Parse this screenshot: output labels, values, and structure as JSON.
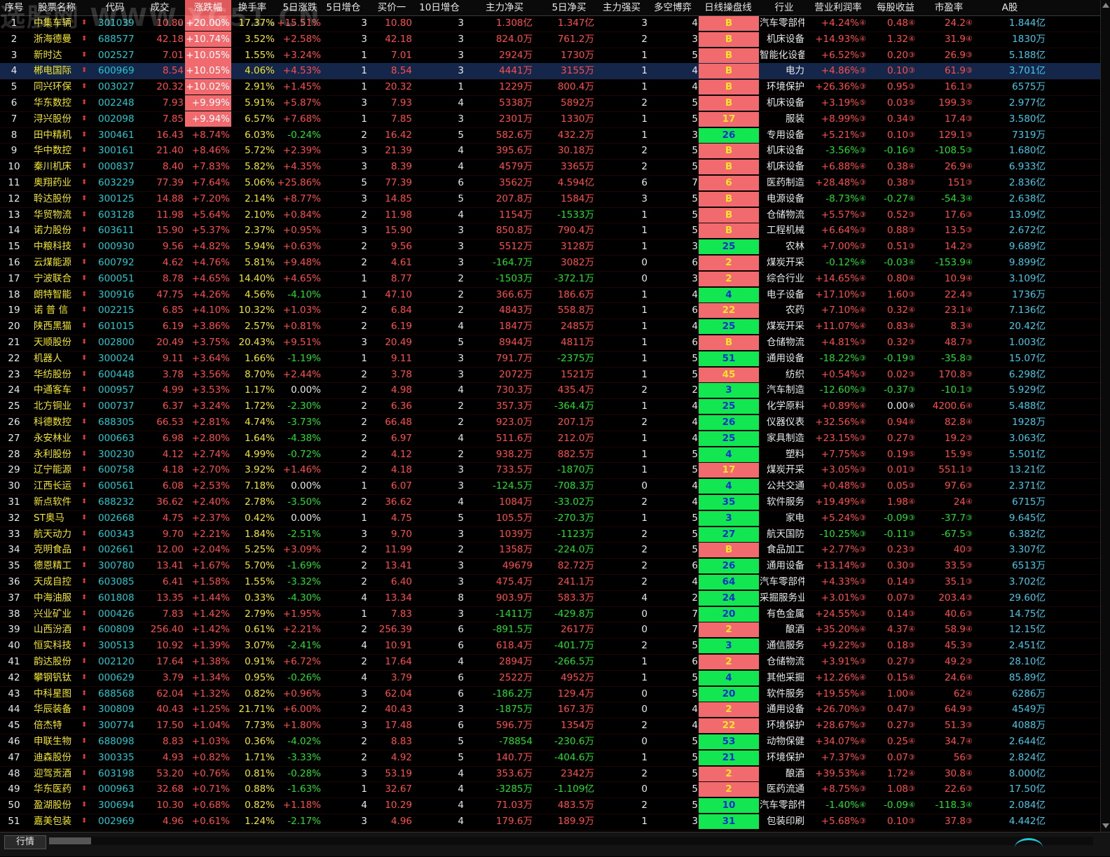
{
  "watermark": "选股网 WWW.XG51.CN",
  "headers": [
    "序号",
    "股票名称",
    "代码",
    "成交",
    "涨跌幅",
    "换手率",
    "5日涨跌",
    "5日增仓",
    "买价一",
    "10日增仓",
    "主力净买",
    "5日净买",
    "主力强买",
    "多空博弈",
    "日线操盘线",
    "行业",
    "营业利润率",
    "每股收益",
    "市盈率",
    "A股"
  ],
  "bottom_tab": "行情",
  "rows": [
    [
      "1",
      "中集车辆",
      "301039",
      "10.80",
      "+20.00%",
      "17.37%",
      "+15.51%",
      "3",
      "10.80",
      "3",
      "1.308亿",
      "1.347亿",
      "3",
      "4",
      "B",
      "汽车零部件",
      "+4.24%",
      "④",
      "0.48",
      "④",
      "24.2",
      "④",
      "1.844亿"
    ],
    [
      "2",
      "浙海德曼",
      "688577",
      "42.18",
      "+10.74%",
      "3.52%",
      "+2.58%",
      "3",
      "42.18",
      "3",
      "824.0万",
      "761.2万",
      "2",
      "3",
      "B",
      "机床设备",
      "+14.93%",
      "④",
      "1.32",
      "④",
      "31.9",
      "④",
      "1830万"
    ],
    [
      "3",
      "新时达",
      "002527",
      "7.01",
      "+10.05%",
      "1.55%",
      "+3.24%",
      "1",
      "7.01",
      "3",
      "2924万",
      "1730万",
      "1",
      "5",
      "B",
      "智能化设备",
      "+6.52%",
      "③",
      "0.20",
      "③",
      "26.9",
      "③",
      "5.188亿"
    ],
    [
      "4",
      "郴电国际",
      "600969",
      "8.54",
      "+10.05%",
      "4.06%",
      "+4.53%",
      "1",
      "8.54",
      "3",
      "4441万",
      "3155万",
      "1",
      "4",
      "B",
      "电力",
      "+4.86%",
      "③",
      "0.10",
      "③",
      "61.9",
      "③",
      "3.701亿"
    ],
    [
      "5",
      "同兴环保",
      "003027",
      "20.32",
      "+10.02%",
      "2.91%",
      "+1.45%",
      "1",
      "20.32",
      "1",
      "1229万",
      "800.4万",
      "1",
      "4",
      "B",
      "环境保护",
      "+26.36%",
      "③",
      "0.95",
      "③",
      "16.1",
      "③",
      "6575万"
    ],
    [
      "6",
      "华东数控",
      "002248",
      "7.93",
      "+9.99%",
      "5.91%",
      "+5.87%",
      "3",
      "7.93",
      "4",
      "5338万",
      "5892万",
      "2",
      "5",
      "B",
      "机床设备",
      "+3.19%",
      "⑤",
      "0.03",
      "⑤",
      "199.3",
      "⑤",
      "2.977亿"
    ],
    [
      "7",
      "浔兴股份",
      "002098",
      "7.85",
      "+9.94%",
      "6.57%",
      "+7.68%",
      "1",
      "7.85",
      "3",
      "2301万",
      "1330万",
      "1",
      "5",
      "17",
      "服装",
      "+8.99%",
      "③",
      "0.34",
      "③",
      "17.4",
      "③",
      "3.580亿"
    ],
    [
      "8",
      "田中精机",
      "300461",
      "16.43",
      "+8.74%",
      "6.03%",
      "-0.24%",
      "2",
      "16.42",
      "5",
      "582.6万",
      "432.2万",
      "1",
      "3",
      "26",
      "专用设备",
      "+5.21%",
      "③",
      "0.10",
      "③",
      "129.1",
      "③",
      "7319万"
    ],
    [
      "9",
      "华中数控",
      "300161",
      "21.40",
      "+8.46%",
      "5.72%",
      "+2.39%",
      "3",
      "21.39",
      "4",
      "395.6万",
      "30.18万",
      "2",
      "5",
      "B",
      "机床设备",
      "-3.56%",
      "③",
      "-0.16",
      "③",
      "-108.5",
      "③",
      "1.680亿"
    ],
    [
      "10",
      "秦川机床",
      "000837",
      "8.40",
      "+7.83%",
      "5.82%",
      "+4.35%",
      "3",
      "8.39",
      "4",
      "4579万",
      "3365万",
      "2",
      "5",
      "B",
      "机床设备",
      "+6.88%",
      "④",
      "0.38",
      "④",
      "26.9",
      "④",
      "6.933亿"
    ],
    [
      "11",
      "奥翔药业",
      "603229",
      "77.39",
      "+7.64%",
      "5.06%",
      "+25.86%",
      "5",
      "77.39",
      "6",
      "3562万",
      "4.594亿",
      "6",
      "7",
      "6",
      "医药制造",
      "+28.48%",
      "③",
      "0.38",
      "③",
      "151",
      "③",
      "2.836亿"
    ],
    [
      "12",
      "聆达股份",
      "300125",
      "14.88",
      "+7.20%",
      "2.14%",
      "+8.77%",
      "3",
      "14.85",
      "5",
      "207.8万",
      "1584万",
      "3",
      "5",
      "B",
      "电源设备",
      "-8.73%",
      "④",
      "-0.27",
      "④",
      "-54.3",
      "④",
      "2.638亿"
    ],
    [
      "13",
      "华贸物流",
      "603128",
      "11.98",
      "+5.64%",
      "2.10%",
      "+0.84%",
      "2",
      "11.98",
      "4",
      "1154万",
      "-1533万",
      "1",
      "5",
      "B",
      "仓储物流",
      "+5.57%",
      "③",
      "0.52",
      "③",
      "17.6",
      "③",
      "13.09亿"
    ],
    [
      "14",
      "诺力股份",
      "603611",
      "15.90",
      "+5.37%",
      "2.37%",
      "+0.95%",
      "3",
      "15.90",
      "3",
      "850.8万",
      "790.4万",
      "1",
      "5",
      "B",
      "工程机械",
      "+6.64%",
      "③",
      "0.88",
      "③",
      "13.5",
      "③",
      "2.672亿"
    ],
    [
      "15",
      "中粮科技",
      "000930",
      "9.56",
      "+4.82%",
      "5.94%",
      "+0.63%",
      "2",
      "9.56",
      "3",
      "5512万",
      "3128万",
      "1",
      "3",
      "25",
      "农林",
      "+7.00%",
      "③",
      "0.51",
      "③",
      "14.2",
      "③",
      "9.689亿"
    ],
    [
      "16",
      "云煤能源",
      "600792",
      "4.62",
      "+4.76%",
      "5.81%",
      "+9.48%",
      "2",
      "4.61",
      "3",
      "-164.7万",
      "3082万",
      "0",
      "6",
      "2",
      "煤炭开采",
      "-0.12%",
      "④",
      "-0.03",
      "④",
      "-153.9",
      "④",
      "9.899亿"
    ],
    [
      "17",
      "宁波联合",
      "600051",
      "8.78",
      "+4.65%",
      "14.40%",
      "+4.65%",
      "1",
      "8.77",
      "2",
      "-1503万",
      "-372.1万",
      "0",
      "3",
      "2",
      "综合行业",
      "+14.65%",
      "④",
      "0.80",
      "④",
      "10.9",
      "④",
      "3.109亿"
    ],
    [
      "18",
      "朗特智能",
      "300916",
      "47.75",
      "+4.26%",
      "4.56%",
      "-4.10%",
      "1",
      "47.10",
      "2",
      "366.6万",
      "186.6万",
      "1",
      "4",
      "4",
      "电子设备",
      "+17.10%",
      "③",
      "1.60",
      "③",
      "22.4",
      "③",
      "1736万"
    ],
    [
      "19",
      "诺 普 信",
      "002215",
      "6.85",
      "+4.10%",
      "10.32%",
      "+1.03%",
      "2",
      "6.84",
      "2",
      "4843万",
      "558.8万",
      "1",
      "6",
      "22",
      "农药",
      "+7.10%",
      "④",
      "0.32",
      "④",
      "23.1",
      "④",
      "7.136亿"
    ],
    [
      "20",
      "陕西黑猫",
      "601015",
      "6.19",
      "+3.86%",
      "2.57%",
      "+0.81%",
      "2",
      "6.19",
      "4",
      "1847万",
      "2485万",
      "1",
      "4",
      "25",
      "煤炭开采",
      "+11.07%",
      "④",
      "0.83",
      "④",
      "8.3",
      "④",
      "20.42亿"
    ],
    [
      "21",
      "天顺股份",
      "002800",
      "20.49",
      "+3.75%",
      "20.43%",
      "+9.51%",
      "3",
      "20.49",
      "5",
      "8944万",
      "4811万",
      "1",
      "6",
      "B",
      "仓储物流",
      "+4.81%",
      "③",
      "0.32",
      "③",
      "48.7",
      "③",
      "1.003亿"
    ],
    [
      "22",
      "机器人",
      "300024",
      "9.11",
      "+3.64%",
      "1.66%",
      "-1.19%",
      "1",
      "9.11",
      "3",
      "791.7万",
      "-2375万",
      "1",
      "5",
      "51",
      "通用设备",
      "-18.22%",
      "③",
      "-0.19",
      "③",
      "-35.8",
      "③",
      "15.07亿"
    ],
    [
      "23",
      "华纺股份",
      "600448",
      "3.78",
      "+3.56%",
      "8.70%",
      "+2.44%",
      "2",
      "3.78",
      "3",
      "2072万",
      "1521万",
      "1",
      "5",
      "45",
      "纺织",
      "+0.54%",
      "③",
      "0.02",
      "③",
      "170.8",
      "③",
      "6.298亿"
    ],
    [
      "24",
      "中通客车",
      "000957",
      "4.99",
      "+3.53%",
      "1.17%",
      "0.00%",
      "2",
      "4.98",
      "4",
      "730.3万",
      "435.4万",
      "2",
      "2",
      "3",
      "汽车制造",
      "-12.60%",
      "③",
      "-0.37",
      "③",
      "-10.1",
      "③",
      "5.929亿"
    ],
    [
      "25",
      "北方铜业",
      "000737",
      "6.37",
      "+3.24%",
      "1.72%",
      "-2.30%",
      "2",
      "6.36",
      "2",
      "357.3万",
      "-364.4万",
      "1",
      "4",
      "25",
      "化学原料",
      "+0.89%",
      "④",
      "0.00",
      "④",
      "4200.6",
      "④",
      "5.488亿"
    ],
    [
      "26",
      "科德数控",
      "688305",
      "66.53",
      "+2.81%",
      "4.74%",
      "-3.73%",
      "2",
      "66.48",
      "2",
      "923.0万",
      "207.1万",
      "2",
      "4",
      "26",
      "仪器仪表",
      "+32.56%",
      "④",
      "0.94",
      "④",
      "82.8",
      "④",
      "1928万"
    ],
    [
      "27",
      "永安林业",
      "000663",
      "6.98",
      "+2.80%",
      "1.64%",
      "-4.38%",
      "2",
      "6.97",
      "4",
      "511.6万",
      "212.0万",
      "1",
      "4",
      "25",
      "家具制造",
      "+23.15%",
      "③",
      "0.27",
      "③",
      "19.2",
      "③",
      "3.063亿"
    ],
    [
      "28",
      "永利股份",
      "300230",
      "4.12",
      "+2.74%",
      "4.99%",
      "-0.72%",
      "2",
      "4.12",
      "2",
      "938.2万",
      "882.5万",
      "1",
      "5",
      "4",
      "塑料",
      "+7.75%",
      "⑤",
      "0.19",
      "⑤",
      "15.9",
      "⑤",
      "5.501亿"
    ],
    [
      "29",
      "辽宁能源",
      "600758",
      "4.18",
      "+2.70%",
      "3.92%",
      "+1.46%",
      "2",
      "4.18",
      "3",
      "733.5万",
      "-1870万",
      "1",
      "5",
      "17",
      "煤炭开采",
      "+3.05%",
      "③",
      "0.01",
      "③",
      "551.1",
      "③",
      "13.21亿"
    ],
    [
      "30",
      "江西长运",
      "600561",
      "6.08",
      "+2.53%",
      "7.18%",
      "0.00%",
      "1",
      "6.07",
      "3",
      "-124.5万",
      "-708.3万",
      "0",
      "4",
      "4",
      "公共交通",
      "+0.48%",
      "③",
      "0.05",
      "③",
      "97.6",
      "③",
      "2.371亿"
    ],
    [
      "31",
      "新点软件",
      "688232",
      "36.62",
      "+2.40%",
      "2.78%",
      "-3.50%",
      "2",
      "36.62",
      "4",
      "1084万",
      "-33.02万",
      "2",
      "4",
      "35",
      "软件服务",
      "+19.49%",
      "④",
      "1.98",
      "④",
      "24",
      "④",
      "6715万"
    ],
    [
      "32",
      "ST奥马",
      "002668",
      "4.75",
      "+2.37%",
      "0.42%",
      "0.00%",
      "1",
      "4.75",
      "5",
      "105.5万",
      "-270.3万",
      "1",
      "5",
      "3",
      "家电",
      "+5.24%",
      "③",
      "-0.09",
      "③",
      "-37.7",
      "③",
      "9.645亿"
    ],
    [
      "33",
      "航天动力",
      "600343",
      "9.70",
      "+2.21%",
      "1.84%",
      "-2.51%",
      "3",
      "9.70",
      "3",
      "1039万",
      "-1123万",
      "2",
      "5",
      "27",
      "航天国防",
      "-10.25%",
      "③",
      "-0.11",
      "③",
      "-67.5",
      "③",
      "6.382亿"
    ],
    [
      "34",
      "克明食品",
      "002661",
      "12.00",
      "+2.04%",
      "5.25%",
      "+3.09%",
      "2",
      "11.99",
      "2",
      "1358万",
      "-224.0万",
      "2",
      "5",
      "B",
      "食品加工",
      "+2.77%",
      "③",
      "0.23",
      "③",
      "40",
      "③",
      "3.307亿"
    ],
    [
      "35",
      "德恩精工",
      "300780",
      "13.41",
      "+1.67%",
      "5.70%",
      "-1.69%",
      "2",
      "13.41",
      "3",
      "49679",
      "82.72万",
      "2",
      "6",
      "26",
      "通用设备",
      "+13.14%",
      "③",
      "0.30",
      "③",
      "33.5",
      "③",
      "6513万"
    ],
    [
      "36",
      "天成自控",
      "603085",
      "6.41",
      "+1.58%",
      "1.55%",
      "-3.32%",
      "2",
      "6.40",
      "3",
      "475.4万",
      "241.1万",
      "2",
      "4",
      "64",
      "汽车零部件",
      "+4.33%",
      "③",
      "0.14",
      "③",
      "35.1",
      "③",
      "3.702亿"
    ],
    [
      "37",
      "中海油服",
      "601808",
      "13.35",
      "+1.44%",
      "0.33%",
      "-4.30%",
      "4",
      "13.34",
      "8",
      "903.9万",
      "583.3万",
      "4",
      "2",
      "24",
      "采掘服务业",
      "+3.01%",
      "③",
      "0.07",
      "③",
      "203.4",
      "③",
      "29.60亿"
    ],
    [
      "38",
      "兴业矿业",
      "000426",
      "7.83",
      "+1.42%",
      "2.79%",
      "+1.95%",
      "1",
      "7.83",
      "3",
      "-1411万",
      "-429.8万",
      "0",
      "7",
      "20",
      "有色金属",
      "+24.55%",
      "③",
      "0.14",
      "③",
      "40.6",
      "③",
      "14.75亿"
    ],
    [
      "39",
      "山西汾酒",
      "600809",
      "256.40",
      "+1.42%",
      "0.61%",
      "+2.21%",
      "2",
      "256.39",
      "6",
      "-891.5万",
      "2617万",
      "0",
      "7",
      "2",
      "酿酒",
      "+35.20%",
      "④",
      "4.37",
      "④",
      "58.9",
      "④",
      "12.15亿"
    ],
    [
      "40",
      "恒实科技",
      "300513",
      "10.92",
      "+1.39%",
      "3.07%",
      "-2.41%",
      "4",
      "10.91",
      "6",
      "618.4万",
      "-401.7万",
      "2",
      "5",
      "3",
      "通信服务",
      "+9.22%",
      "③",
      "0.18",
      "③",
      "45.3",
      "③",
      "2.451亿"
    ],
    [
      "41",
      "韵达股份",
      "002120",
      "17.64",
      "+1.38%",
      "0.91%",
      "+6.72%",
      "2",
      "17.64",
      "4",
      "2894万",
      "-266.5万",
      "1",
      "6",
      "2",
      "仓储物流",
      "+3.91%",
      "③",
      "0.27",
      "③",
      "49.2",
      "③",
      "28.10亿"
    ],
    [
      "42",
      "攀钢钒钛",
      "000629",
      "3.79",
      "+1.34%",
      "0.95%",
      "-0.26%",
      "4",
      "3.79",
      "6",
      "2522万",
      "4952万",
      "1",
      "5",
      "4",
      "其他采掘",
      "+12.26%",
      "④",
      "0.15",
      "④",
      "24.6",
      "④",
      "85.89亿"
    ],
    [
      "43",
      "中科星图",
      "688568",
      "62.04",
      "+1.32%",
      "0.82%",
      "+0.96%",
      "3",
      "62.04",
      "6",
      "-186.2万",
      "129.4万",
      "0",
      "5",
      "20",
      "软件服务",
      "+19.55%",
      "④",
      "1.00",
      "④",
      "62",
      "④",
      "6286万"
    ],
    [
      "44",
      "华辰装备",
      "300809",
      "40.43",
      "+1.25%",
      "21.71%",
      "+6.00%",
      "2",
      "40.43",
      "3",
      "-1875万",
      "167.3万",
      "0",
      "4",
      "2",
      "通用设备",
      "+26.70%",
      "③",
      "0.47",
      "③",
      "64.9",
      "③",
      "4549万"
    ],
    [
      "45",
      "倍杰特",
      "300774",
      "17.50",
      "+1.04%",
      "7.73%",
      "+1.80%",
      "3",
      "17.48",
      "6",
      "596.7万",
      "1354万",
      "2",
      "4",
      "22",
      "环境保护",
      "+28.67%",
      "③",
      "0.27",
      "③",
      "51.3",
      "③",
      "4088万"
    ],
    [
      "46",
      "申联生物",
      "688098",
      "8.83",
      "+1.03%",
      "0.36%",
      "-4.02%",
      "2",
      "8.83",
      "5",
      "-78854",
      "-230.6万",
      "0",
      "5",
      "53",
      "动物保健",
      "+34.07%",
      "④",
      "0.25",
      "④",
      "34.7",
      "④",
      "2.644亿"
    ],
    [
      "47",
      "迪森股份",
      "300335",
      "4.93",
      "+0.82%",
      "1.71%",
      "-3.33%",
      "2",
      "4.92",
      "5",
      "140.7万",
      "-404.6万",
      "1",
      "5",
      "21",
      "环境保护",
      "+7.37%",
      "③",
      "0.07",
      "③",
      "56",
      "③",
      "2.824亿"
    ],
    [
      "48",
      "迎驾贡酒",
      "603198",
      "53.20",
      "+0.76%",
      "0.81%",
      "-0.28%",
      "3",
      "53.19",
      "4",
      "353.6万",
      "2342万",
      "2",
      "5",
      "2",
      "酿酒",
      "+39.53%",
      "④",
      "1.72",
      "④",
      "30.8",
      "④",
      "8.000亿"
    ],
    [
      "49",
      "华东医药",
      "000963",
      "32.68",
      "+0.71%",
      "0.88%",
      "-1.63%",
      "1",
      "32.67",
      "4",
      "-3285万",
      "-1.109亿",
      "0",
      "5",
      "2",
      "医药流通",
      "+8.75%",
      "③",
      "1.08",
      "③",
      "22.6",
      "③",
      "17.50亿"
    ],
    [
      "50",
      "盈湖股份",
      "300694",
      "10.30",
      "+0.68%",
      "0.82%",
      "+1.18%",
      "4",
      "10.29",
      "4",
      "71.03万",
      "483.5万",
      "2",
      "5",
      "10",
      "汽车零部件",
      "-1.40%",
      "④",
      "-0.09",
      "④",
      "-118.3",
      "④",
      "2.084亿"
    ],
    [
      "51",
      "嘉美包装",
      "002969",
      "4.96",
      "+0.61%",
      "1.24%",
      "-2.17%",
      "3",
      "4.96",
      "4",
      "179.6万",
      "189.9万",
      "1",
      "3",
      "31",
      "包装印刷",
      "+5.68%",
      "③",
      "0.10",
      "③",
      "37.8",
      "③",
      "4.442亿"
    ]
  ]
}
